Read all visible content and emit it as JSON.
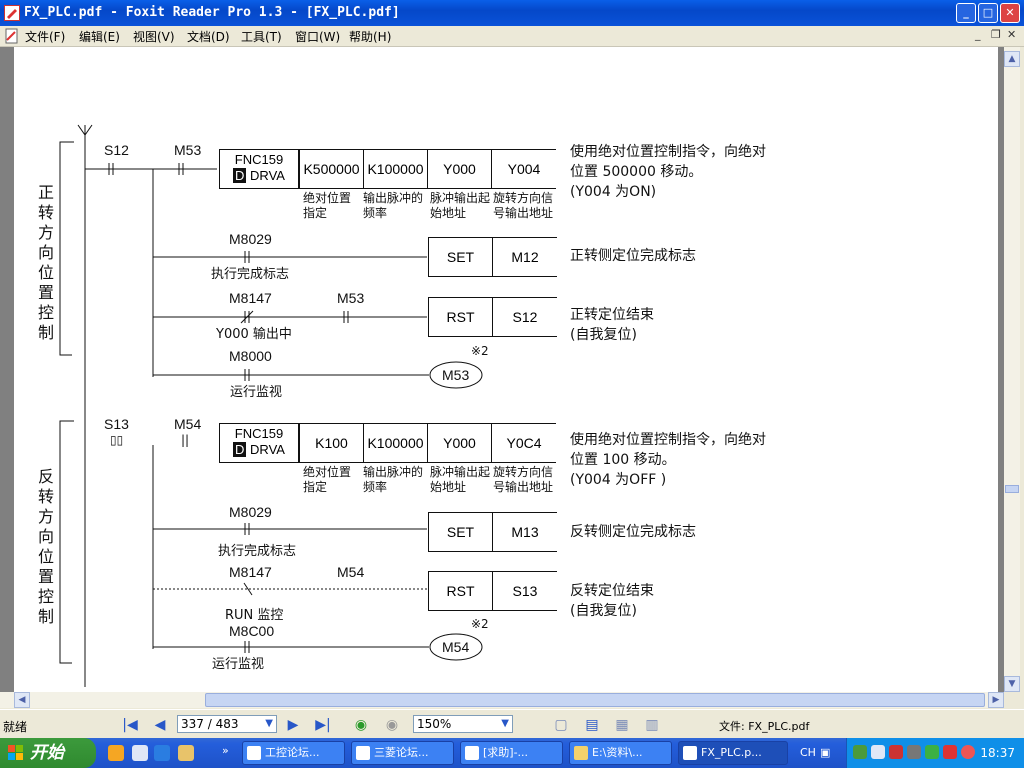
{
  "window": {
    "title": "FX_PLC.pdf - Foxit Reader Pro 1.3 - [FX_PLC.pdf]"
  },
  "menu": [
    {
      "label": "文件(F)"
    },
    {
      "label": "编辑(E)"
    },
    {
      "label": "视图(V)"
    },
    {
      "label": "文档(D)"
    },
    {
      "label": "工具(T)"
    },
    {
      "label": "窗口(W)"
    },
    {
      "label": "帮助(H)"
    }
  ],
  "diagram": {
    "forward": {
      "section_label": "正转方向位置控制",
      "step": "S12",
      "relay": "M53",
      "instr": {
        "fnc": "FNC159",
        "d": "D",
        "name": "DRVA",
        "args": [
          "K500000",
          "K100000",
          "Y000",
          "Y004"
        ]
      },
      "arg_notes": [
        "绝对位置指定",
        "输出脉冲的频率",
        "脉冲输出起始地址",
        "旋转方向信号输出地址"
      ],
      "desc": [
        "使用绝对位置控制指令，向绝对",
        "位置 500000 移动。",
        "(Y004 为ON)"
      ],
      "rung2": {
        "contact": "M8029",
        "contact_note": "执行完成标志",
        "op": "SET",
        "target": "M12",
        "desc": "正转侧定位完成标志"
      },
      "rung3": {
        "contact": "M8147",
        "contact_note": "Y000 输出中",
        "contact2": "M53",
        "op": "RST",
        "target": "S12",
        "desc": [
          "正转定位结束",
          "(自我复位)"
        ]
      },
      "rung4": {
        "contact": "M8000",
        "contact_note": "运行监视",
        "coil": "M53",
        "mark": "※2"
      }
    },
    "reverse": {
      "section_label": "反转方向位置控制",
      "step": "S13",
      "relay": "M54",
      "instr": {
        "fnc": "FNC159",
        "d": "D",
        "name": "DRVA",
        "args": [
          "K100",
          "K100000",
          "Y000",
          "Y0C4"
        ]
      },
      "arg_notes": [
        "绝对位置指定",
        "输出脉冲的频率",
        "脉冲输出起始地址",
        "旋转方向信号输出地址"
      ],
      "desc": [
        "使用绝对位置控制指令，向绝对",
        "位置 100 移动。",
        "(Y004 为OFF )"
      ],
      "rung2": {
        "contact": "M8029",
        "contact_note": "执行完成标志",
        "op": "SET",
        "target": "M13",
        "desc": "反转侧定位完成标志"
      },
      "rung3": {
        "contact": "M8147",
        "contact_note": "RUN 监控",
        "contact2": "M54",
        "op": "RST",
        "target": "S13",
        "desc": [
          "反转定位结束",
          "(自我复位)"
        ]
      },
      "rung4": {
        "contact": "M8C00",
        "contact_note": "运行监视",
        "coil": "M54",
        "mark": "※2"
      }
    }
  },
  "status": {
    "ready": "就绪",
    "page": "337 / 483",
    "zoom": "150%",
    "file": "文件: FX_PLC.pdf"
  },
  "taskbar": {
    "start": "开始",
    "tasks": [
      {
        "label": "工控论坛..."
      },
      {
        "label": "三菱论坛..."
      },
      {
        "label": "[求助]-..."
      },
      {
        "label": "E:\\资料\\..."
      },
      {
        "label": "FX_PLC.p..."
      }
    ],
    "lang": "CH",
    "clock": "18:37"
  }
}
